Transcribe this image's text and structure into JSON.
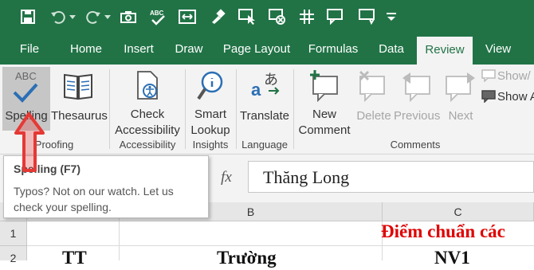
{
  "quick_access": {
    "icons": [
      "save-icon",
      "undo-icon",
      "redo-icon",
      "camera-icon",
      "spelling-abc-icon",
      "fit-columns-icon",
      "format-painter-icon",
      "select-pointer-icon",
      "clear-format-icon",
      "freeze-panes-icon",
      "comment-icon"
    ]
  },
  "tabs": [
    {
      "label": "File"
    },
    {
      "label": "Home"
    },
    {
      "label": "Insert"
    },
    {
      "label": "Draw"
    },
    {
      "label": "Page Layout"
    },
    {
      "label": "Formulas"
    },
    {
      "label": "Data"
    },
    {
      "label": "Review"
    },
    {
      "label": "View"
    }
  ],
  "active_tab": "Review",
  "ribbon": {
    "spelling": {
      "label": "Spelling",
      "icon_text": "ABC"
    },
    "thesaurus": {
      "label": "Thesaurus"
    },
    "check_accessibility": {
      "line1": "Check",
      "line2": "Accessibility"
    },
    "smart_lookup": {
      "line1": "Smart",
      "line2": "Lookup"
    },
    "translate": {
      "label": "Translate"
    },
    "new_comment": {
      "line1": "New",
      "line2": "Comment"
    },
    "delete": {
      "label": "Delete"
    },
    "previous": {
      "label": "Previous"
    },
    "next": {
      "label": "Next"
    },
    "show_hide": {
      "label": "Show/"
    },
    "show_all": {
      "label": "Show A"
    },
    "groups": {
      "proofing": "Proofing",
      "accessibility": "Accessibility",
      "insights": "Insights",
      "language": "Language",
      "comments": "Comments"
    }
  },
  "formula_bar": {
    "fx": "fx",
    "content": "Thăng Long"
  },
  "sheet": {
    "columns": [
      "B",
      "C"
    ],
    "rows": [
      "1",
      "2"
    ],
    "c1": "Điểm chuẩn các",
    "a2": "TT",
    "b2": "Trường",
    "c2": "NV1"
  },
  "tooltip": {
    "title": "Spelling (F7)",
    "body": "Typos? Not on our watch. Let us check your spelling."
  },
  "colors": {
    "excel_green": "#217346",
    "annotation_red": "#e53935",
    "title_red": "#e00000"
  }
}
